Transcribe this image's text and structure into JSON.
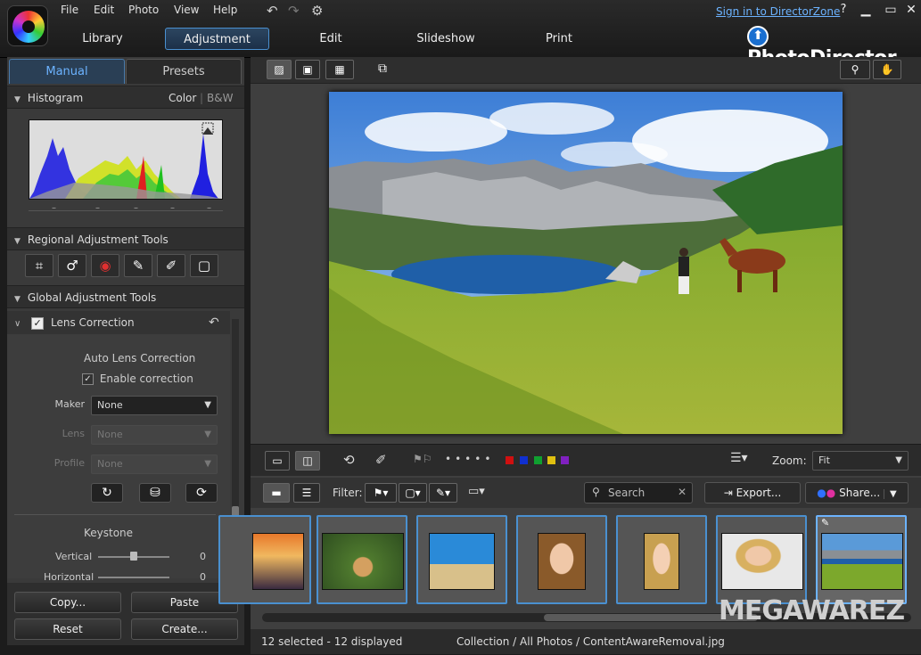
{
  "menu": {
    "file": "File",
    "edit": "Edit",
    "photo": "Photo",
    "view": "View",
    "help": "Help"
  },
  "header": {
    "signin": "Sign in to DirectorZone",
    "help": "?",
    "brand": "PhotoDirector"
  },
  "modes": [
    "Library",
    "Adjustment",
    "Edit",
    "Slideshow",
    "Print"
  ],
  "panel": {
    "tabs": [
      "Manual",
      "Presets"
    ],
    "histogram": {
      "title": "Histogram",
      "color": "Color",
      "bw": "B&W"
    },
    "regional": {
      "title": "Regional Adjustment Tools"
    },
    "global": {
      "title": "Global Adjustment Tools"
    },
    "lens": {
      "title": "Lens Correction",
      "auto": "Auto Lens Correction",
      "enable": "Enable correction",
      "maker_label": "Maker",
      "maker_value": "None",
      "lens_label": "Lens",
      "lens_value": "None",
      "profile_label": "Profile",
      "profile_value": "None"
    },
    "keystone": {
      "title": "Keystone",
      "vertical_label": "Vertical",
      "vertical_value": "0",
      "horizontal_label": "Horizontal",
      "horizontal_value": "0"
    },
    "actions": {
      "copy": "Copy...",
      "paste": "Paste",
      "reset": "Reset",
      "create": "Create..."
    }
  },
  "toolbar": {
    "zoom_label": "Zoom:",
    "zoom_value": "Fit",
    "filter_label": "Filter:",
    "search_placeholder": "Search",
    "export": "Export...",
    "share": "Share..."
  },
  "colors": {
    "swatches": [
      "#d01010",
      "#1030d0",
      "#10a030",
      "#e0c010",
      "#8020c0"
    ],
    "accent": "#4a90d0"
  },
  "status": {
    "selected": "12 selected - 12 displayed",
    "path": "Collection / All Photos / ContentAwareRemoval.jpg"
  },
  "watermark": "MEGAWAREZ"
}
